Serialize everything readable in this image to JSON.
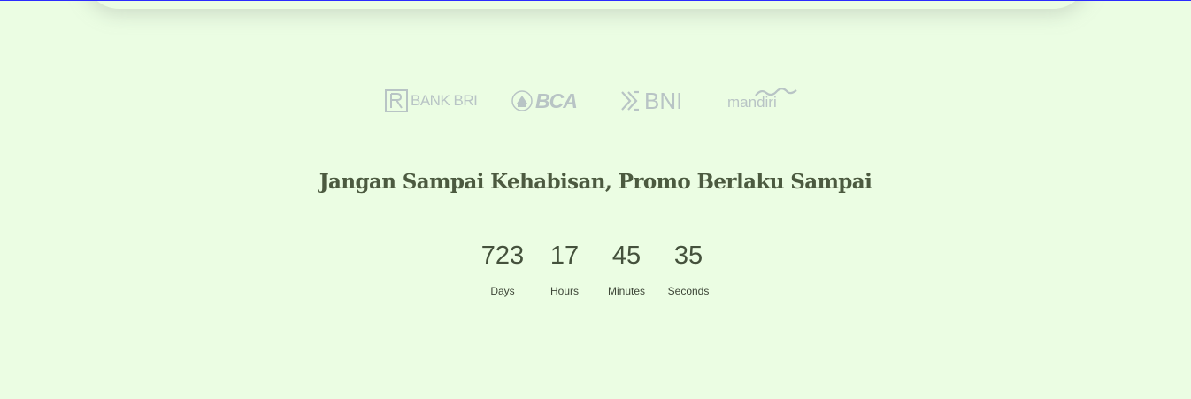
{
  "banks": [
    {
      "name": "BANK BRI",
      "icon": "bri-logo-icon"
    },
    {
      "name": "BCA",
      "icon": "bca-logo-icon"
    },
    {
      "name": "BNI",
      "icon": "bni-logo-icon"
    },
    {
      "name": "mandiri",
      "icon": "mandiri-logo-icon"
    }
  ],
  "promo": {
    "headline": "Jangan Sampai Kehabisan, Promo Berlaku Sampai"
  },
  "countdown": {
    "days": {
      "value": "723",
      "label": "Days"
    },
    "hours": {
      "value": "17",
      "label": "Hours"
    },
    "minutes": {
      "value": "45",
      "label": "Minutes"
    },
    "seconds": {
      "value": "35",
      "label": "Seconds"
    }
  },
  "colors": {
    "background": "#ebfde3",
    "headline": "#4c5a40",
    "countdown_text": "#44513c",
    "logo_gray": "#b6c1c4",
    "top_edge": "#2b2bff"
  }
}
